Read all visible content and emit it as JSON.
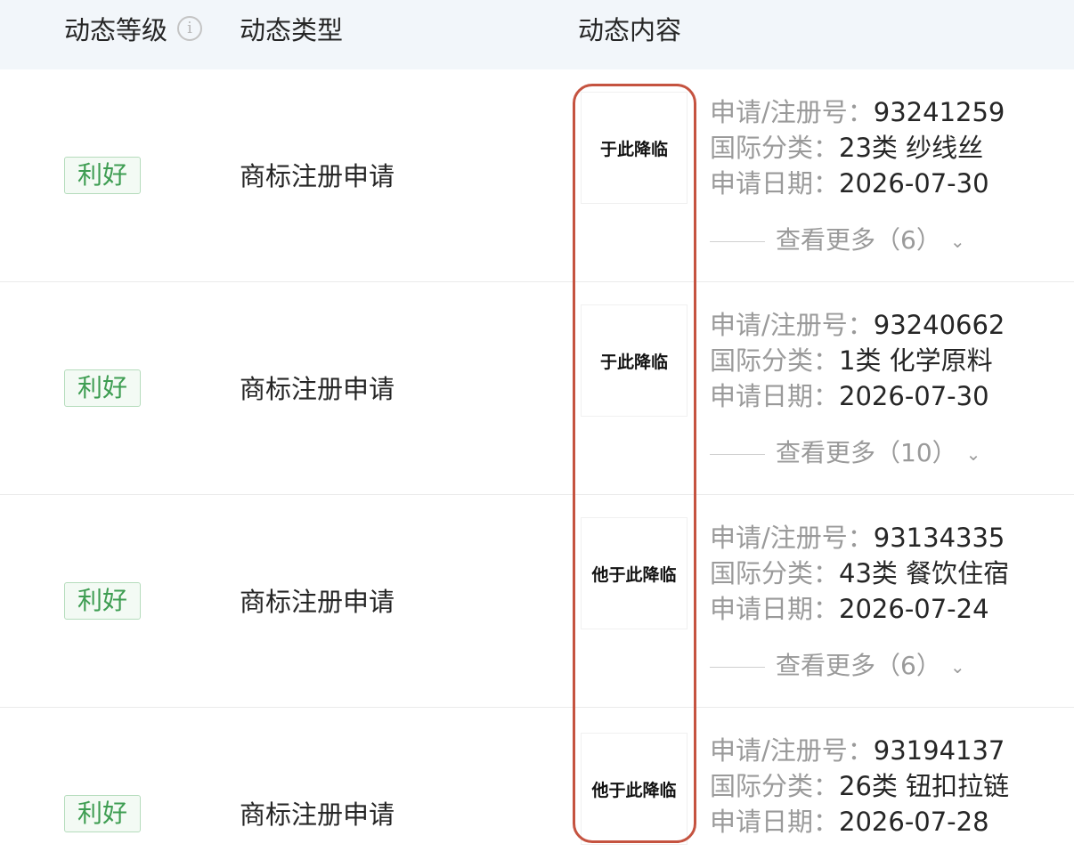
{
  "header": {
    "col_level": "动态等级",
    "col_type": "动态类型",
    "col_content": "动态内容",
    "info_icon_glyph": "i"
  },
  "rows": [
    {
      "level": "利好",
      "type": "商标注册申请",
      "thumb_text": "于此降临",
      "app_label": "申请/注册号：",
      "app_no": "93241259",
      "class_label": "国际分类：",
      "class_value": "23类 纱线丝",
      "date_label": "申请日期：",
      "date": "2026-07-30",
      "more": "查看更多（6）"
    },
    {
      "level": "利好",
      "type": "商标注册申请",
      "thumb_text": "于此降临",
      "app_label": "申请/注册号：",
      "app_no": "93240662",
      "class_label": "国际分类：",
      "class_value": "1类 化学原料",
      "date_label": "申请日期：",
      "date": "2026-07-30",
      "more": "查看更多（10）"
    },
    {
      "level": "利好",
      "type": "商标注册申请",
      "thumb_text": "他于此降临",
      "app_label": "申请/注册号：",
      "app_no": "93134335",
      "class_label": "国际分类：",
      "class_value": "43类 餐饮住宿",
      "date_label": "申请日期：",
      "date": "2026-07-24",
      "more": "查看更多（6）"
    },
    {
      "level": "利好",
      "type": "商标注册申请",
      "thumb_text": "他于此降临",
      "app_label": "申请/注册号：",
      "app_no": "93194137",
      "class_label": "国际分类：",
      "class_value": "26类 钮扣拉链",
      "date_label": "申请日期：",
      "date": "2026-07-28"
    }
  ],
  "colors": {
    "header_bg": "#f2f6fa",
    "badge_green": "#3e9d52",
    "highlight_red": "#c55340",
    "label_gray": "#9a9a9a"
  }
}
